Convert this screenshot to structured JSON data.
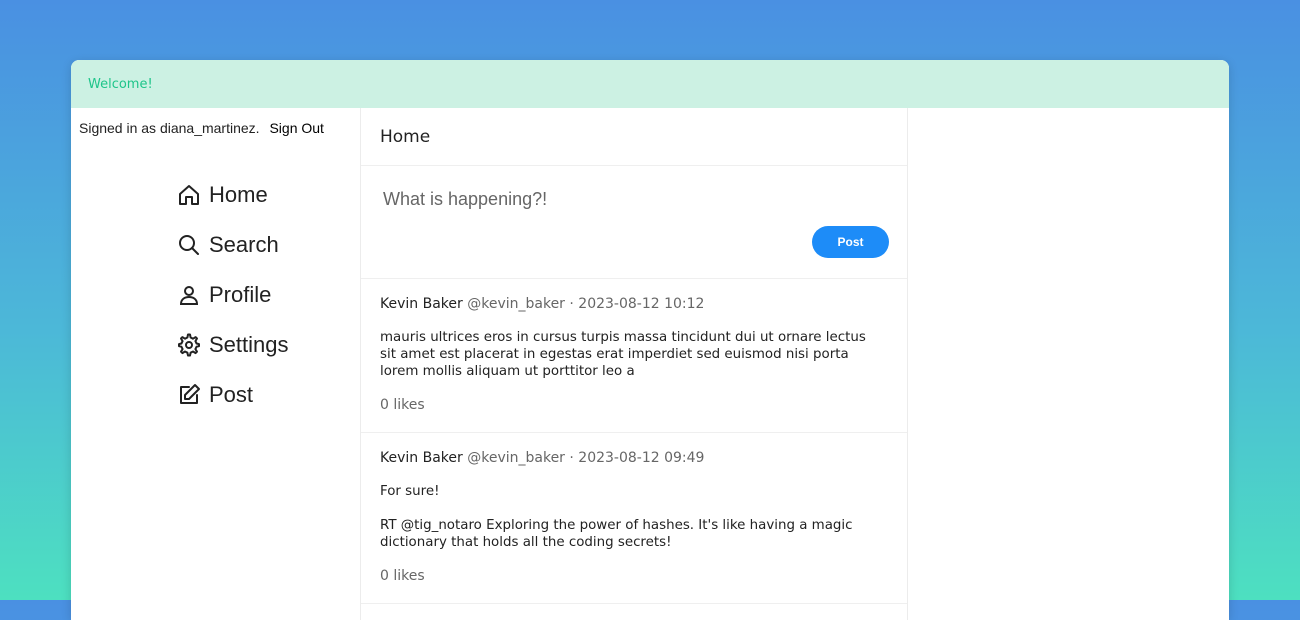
{
  "banner": {
    "message": "Welcome!"
  },
  "session": {
    "signed_in_text": "Signed in as diana_martinez.",
    "signout_label": "Sign Out"
  },
  "nav": {
    "items": [
      {
        "label": "Home",
        "icon": "home-icon"
      },
      {
        "label": "Search",
        "icon": "search-icon"
      },
      {
        "label": "Profile",
        "icon": "user-icon"
      },
      {
        "label": "Settings",
        "icon": "gear-icon"
      },
      {
        "label": "Post",
        "icon": "edit-icon"
      }
    ]
  },
  "main": {
    "title": "Home",
    "composer": {
      "placeholder": "What is happening?!",
      "post_label": "Post"
    },
    "tweets": [
      {
        "name": "Kevin Baker",
        "handle": "@kevin_baker",
        "meta": "· 2023-08-12 10:12",
        "body": "mauris ultrices eros in cursus turpis massa tincidunt dui ut ornare lectus sit amet est placerat in egestas erat imperdiet sed euismod nisi porta lorem mollis aliquam ut porttitor leo a",
        "likes": "0 likes"
      },
      {
        "name": "Kevin Baker",
        "handle": "@kevin_baker",
        "meta": "· 2023-08-12 09:49",
        "body": "For sure!\n\nRT @tig_notaro Exploring the power of hashes. It's like having a magic dictionary that holds all the coding secrets!",
        "likes": "0 likes"
      }
    ]
  },
  "colors": {
    "accent": "#1d8cf8",
    "banner_bg": "#ccf1e3",
    "banner_text": "#1ec58a"
  }
}
